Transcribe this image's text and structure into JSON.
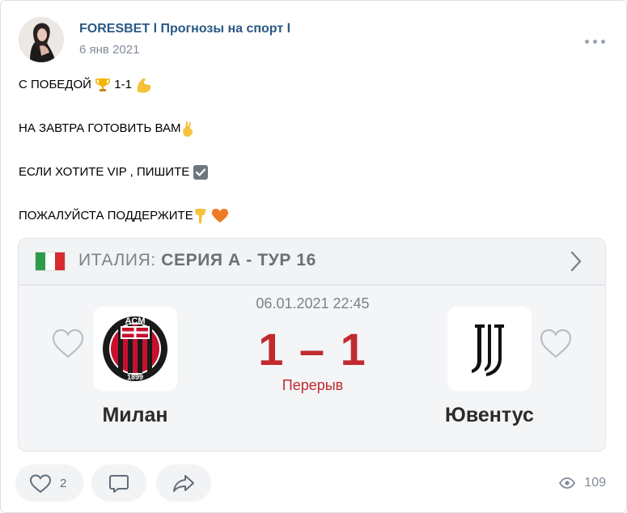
{
  "post": {
    "author": "FORESBET l Прогнозы на спорт l",
    "date": "6 янв 2021",
    "lines": [
      "С ПОБЕДОЙ",
      "1-1",
      "НА ЗАВТРА ГОТОВИТЬ ВАМ",
      "ЕСЛИ ХОТИТЕ VIP , ПИШИТЕ",
      "ПОЖАЛУЙСТА ПОДДЕРЖИТЕ"
    ],
    "icons": [
      "trophy-emoji",
      "flexed-biceps-emoji",
      "crossed-fingers-emoji",
      "check-box-emoji",
      "backhand-pointing-down-emoji",
      "orange-heart-emoji"
    ]
  },
  "match_card": {
    "country": "ИТАЛИЯ:",
    "league": "СЕРИЯ А - ТУР 16",
    "datetime": "06.01.2021 22:45",
    "score": "1 – 1",
    "status": "Перерыв",
    "home_team": "Милан",
    "away_team": "Ювентус",
    "flag_colors": [
      "#2e9b4a",
      "#ffffff",
      "#d52b2f"
    ],
    "home_logo_text": "ACM",
    "home_logo_year": "1899",
    "accent_color": "#c12a2d"
  },
  "actions": {
    "like_count": "2",
    "views": "109"
  }
}
